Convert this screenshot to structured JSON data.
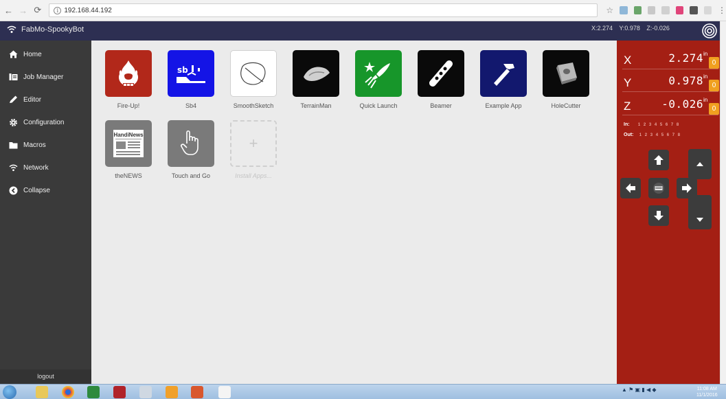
{
  "browser": {
    "url": "192.168.44.192",
    "back_icon": "arrow-left-icon",
    "forward_icon": "arrow-right-icon",
    "reload_icon": "reload-icon",
    "menu_dots": "⋮"
  },
  "header": {
    "brand": "FabMo-SpookyBot",
    "coords": {
      "x": "X:2.274",
      "y": "Y:0.978",
      "z": "Z:-0.026"
    }
  },
  "sidebar": {
    "items": [
      {
        "label": "Home",
        "icon": "home-icon"
      },
      {
        "label": "Job Manager",
        "icon": "job-manager-icon"
      },
      {
        "label": "Editor",
        "icon": "pencil-icon"
      },
      {
        "label": "Configuration",
        "icon": "gear-icon"
      },
      {
        "label": "Macros",
        "icon": "folder-icon"
      },
      {
        "label": "Network",
        "icon": "wifi-icon"
      },
      {
        "label": "Collapse",
        "icon": "collapse-icon"
      }
    ],
    "logout": "logout"
  },
  "apps": [
    {
      "label": "Fire-Up!",
      "color": "#b2281a"
    },
    {
      "label": "Sb4",
      "color": "#1414e6"
    },
    {
      "label": "SmoothSketch",
      "color": "#ffffff"
    },
    {
      "label": "TerrainMan",
      "color": "#0a0a0a"
    },
    {
      "label": "Quick Launch",
      "color": "#17962a"
    },
    {
      "label": "Beamer",
      "color": "#0a0a0a"
    },
    {
      "label": "Example App",
      "color": "#12186e"
    },
    {
      "label": "HoleCutter",
      "color": "#0a0a0a"
    },
    {
      "label": "theNEWS",
      "color": "#7a7a7a",
      "icon_text": "HandiNews"
    },
    {
      "label": "Touch and Go",
      "color": "#7a7a7a"
    }
  ],
  "install": {
    "label": "Install Apps..."
  },
  "dro": {
    "axes": [
      {
        "label": "X",
        "value": "2.274",
        "unit": "in",
        "zero": "0"
      },
      {
        "label": "Y",
        "value": "0.978",
        "unit": "in",
        "zero": "0"
      },
      {
        "label": "Z",
        "value": "-0.026",
        "unit": "in",
        "zero": "0"
      }
    ],
    "inputs_label": "In:",
    "outputs_label": "Out:",
    "pins": [
      "1",
      "2",
      "3",
      "4",
      "5",
      "6",
      "7",
      "8"
    ]
  },
  "taskbar": {
    "clock_time": "11:08 AM",
    "clock_date": "11/1/2016"
  },
  "colors": {
    "header_bg": "#2d2f52",
    "sidebar_bg": "#3a3a3a",
    "dro_bg": "#a41f14",
    "zero_button": "#f0a020"
  }
}
